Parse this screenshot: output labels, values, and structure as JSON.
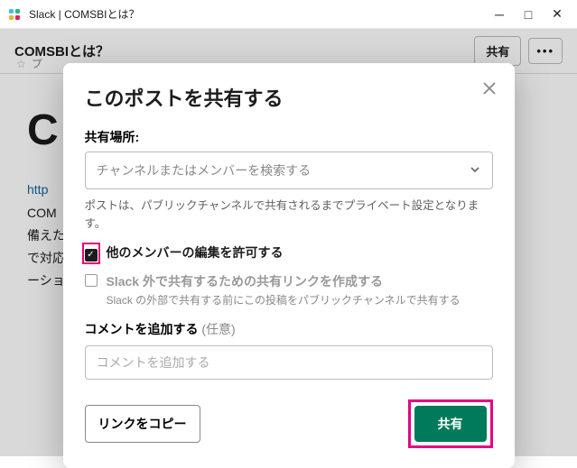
{
  "titlebar": {
    "title": "Slack | COMSBIとは？"
  },
  "header": {
    "title": "COMSBIとは？",
    "sub_prefix": "☆",
    "sub": "プ",
    "share": "共有",
    "more": "•••"
  },
  "content": {
    "heading_fragment": "C",
    "link_fragment": "http",
    "body": "COM                                                                                                    セスをオ                                                                                                    備えた予                                                                                                    存のデー                                                                                                    で対応可                                                                                                    ーションまた                                                                                                    ーション"
  },
  "modal": {
    "title": "このポストを共有する",
    "location_label": "共有場所:",
    "location_placeholder": "チャンネルまたはメンバーを検索する",
    "location_hint": "ポストは、パブリックチャンネルで共有されるまでプライベート設定となります。",
    "allow_edit": "他のメンバーの編集を許可する",
    "external_link": "Slack 外で共有するための共有リンクを作成する",
    "external_sub": "Slack の外部で共有する前にこの投稿をパブリックチャンネルで共有する",
    "comment_label": "コメントを追加する",
    "comment_optional": "(任意)",
    "comment_placeholder": "コメントを追加する",
    "copy": "リンクをコピー",
    "share": "共有"
  }
}
